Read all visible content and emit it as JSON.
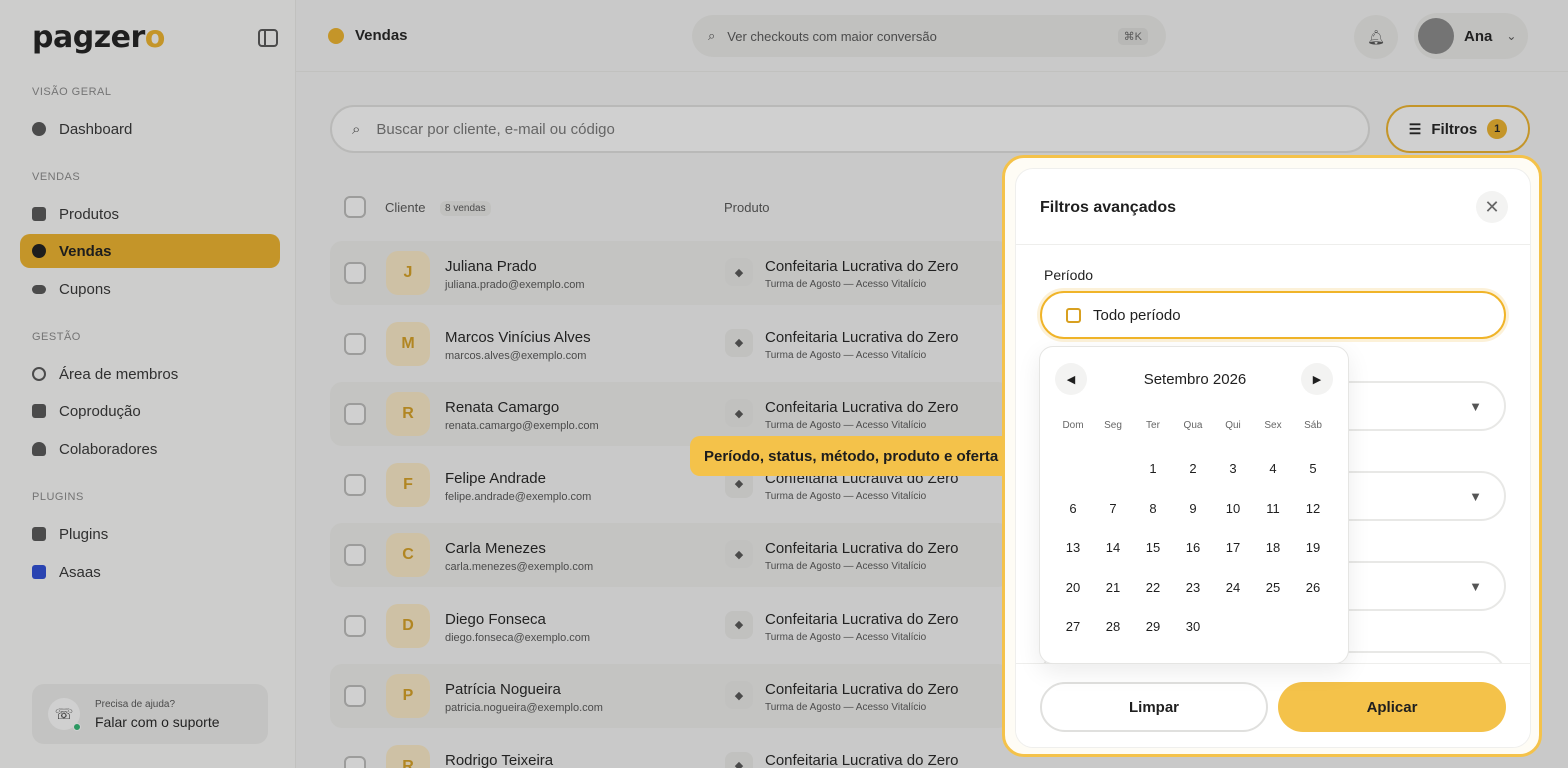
{
  "sidebar": {
    "logo_text": "pagzer",
    "logo_accent": "o",
    "sections": {
      "overview": "VISÃO GERAL",
      "sales": "VENDAS",
      "management": "GESTÃO",
      "plugins": "PLUGINS"
    },
    "items": {
      "dashboard": "Dashboard",
      "products": "Produtos",
      "sales": "Vendas",
      "coupons": "Cupons",
      "members": "Área de membros",
      "coproduction": "Coprodução",
      "collaborators": "Colaboradores",
      "plugins": "Plugins",
      "asaas": "Asaas"
    },
    "support": {
      "question": "Precisa de ajuda?",
      "link": "Falar com o suporte"
    }
  },
  "header": {
    "page_title": "Vendas",
    "command_search": "Ver checkouts com maior conversão",
    "shortcut": "⌘K",
    "user_name": "Ana"
  },
  "toolbar": {
    "search_placeholder": "Buscar por cliente, e-mail ou código",
    "filters_label": "Filtros",
    "filters_count": "1"
  },
  "table": {
    "col_client": "Cliente",
    "sales_count": "8 vendas",
    "col_product": "Produto",
    "rows": [
      {
        "initial": "J",
        "name": "Juliana Prado",
        "email": "juliana.prado@exemplo.com",
        "product": "Confeitaria Lucrativa do Zero",
        "offer": "Turma de Agosto — Acesso Vitalício"
      },
      {
        "initial": "M",
        "name": "Marcos Vinícius Alves",
        "email": "marcos.alves@exemplo.com",
        "product": "Confeitaria Lucrativa do Zero",
        "offer": "Turma de Agosto — Acesso Vitalício"
      },
      {
        "initial": "R",
        "name": "Renata Camargo",
        "email": "renata.camargo@exemplo.com",
        "product": "Confeitaria Lucrativa do Zero",
        "offer": "Turma de Agosto — Acesso Vitalício"
      },
      {
        "initial": "F",
        "name": "Felipe Andrade",
        "email": "felipe.andrade@exemplo.com",
        "product": "Confeitaria Lucrativa do Zero",
        "offer": "Turma de Agosto — Acesso Vitalício"
      },
      {
        "initial": "C",
        "name": "Carla Menezes",
        "email": "carla.menezes@exemplo.com",
        "product": "Confeitaria Lucrativa do Zero",
        "offer": "Turma de Agosto — Acesso Vitalício"
      },
      {
        "initial": "D",
        "name": "Diego Fonseca",
        "email": "diego.fonseca@exemplo.com",
        "product": "Confeitaria Lucrativa do Zero",
        "offer": "Turma de Agosto — Acesso Vitalício"
      },
      {
        "initial": "P",
        "name": "Patrícia Nogueira",
        "email": "patricia.nogueira@exemplo.com",
        "product": "Confeitaria Lucrativa do Zero",
        "offer": "Turma de Agosto — Acesso Vitalício"
      },
      {
        "initial": "R",
        "name": "Rodrigo Teixeira",
        "email": "",
        "product": "Confeitaria Lucrativa do Zero",
        "offer": ""
      }
    ]
  },
  "tooltip": "Período, status, método, produto e oferta",
  "filters_panel": {
    "title": "Filtros avançados",
    "period_label": "Período",
    "period_value": "Todo período",
    "clear": "Limpar",
    "apply": "Aplicar"
  },
  "calendar": {
    "month": "Setembro 2026",
    "weekdays": [
      "Dom",
      "Seg",
      "Ter",
      "Qua",
      "Qui",
      "Sex",
      "Sáb"
    ],
    "days": [
      "",
      "",
      "1",
      "2",
      "3",
      "4",
      "5",
      "6",
      "7",
      "8",
      "9",
      "10",
      "11",
      "12",
      "13",
      "14",
      "15",
      "16",
      "17",
      "18",
      "19",
      "20",
      "21",
      "22",
      "23",
      "24",
      "25",
      "26",
      "27",
      "28",
      "29",
      "30"
    ]
  },
  "colors": {
    "accent": "#f0b429",
    "overlay": "#282828"
  }
}
